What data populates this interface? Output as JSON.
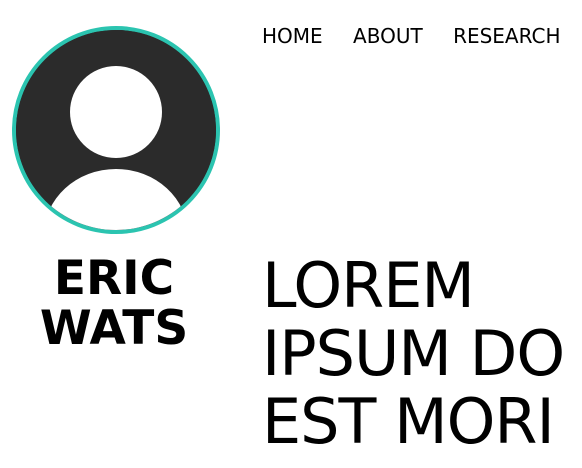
{
  "nav": {
    "items": [
      "HOME",
      "ABOUT",
      "RESEARCH"
    ]
  },
  "profile": {
    "name_line1": "ERIC",
    "name_line2": "WATS",
    "avatar_border_color": "#2bc4b0",
    "avatar_bg_color": "#2b2b2b"
  },
  "hero": {
    "line1": "LOREM",
    "line2": "IPSUM DO",
    "line3": "EST MORI"
  }
}
